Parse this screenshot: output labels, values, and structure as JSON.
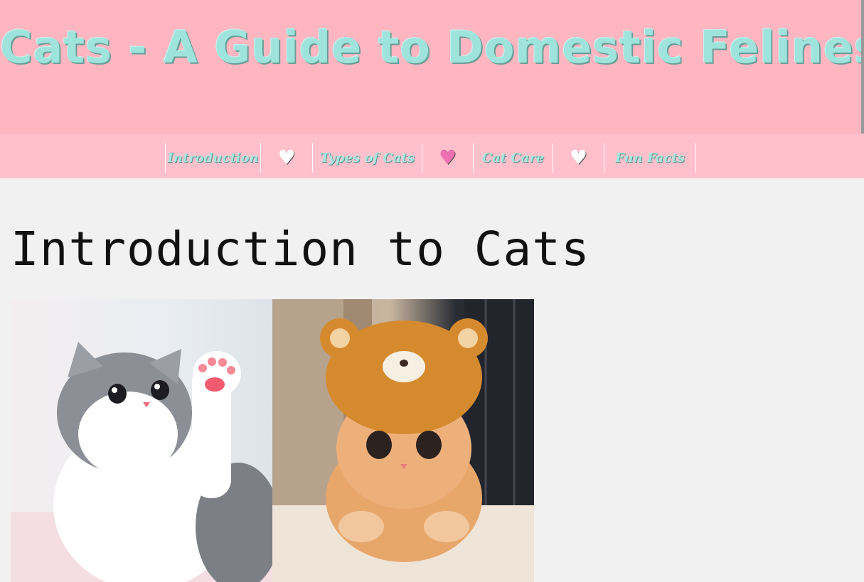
{
  "site": {
    "title": "Cats - A Guide to Domestic Felines"
  },
  "nav": {
    "items": [
      {
        "label": "Introduction",
        "kind": "link"
      },
      {
        "label": "♥",
        "kind": "heart",
        "color": "#ffffff"
      },
      {
        "label": "Types of Cats",
        "kind": "link"
      },
      {
        "label": "♥",
        "kind": "heart",
        "color": "#f06fb0"
      },
      {
        "label": "Cat Care",
        "kind": "link"
      },
      {
        "label": "♥",
        "kind": "heart",
        "color": "#ffffff"
      },
      {
        "label": "Fun Facts",
        "kind": "link"
      }
    ]
  },
  "main": {
    "heading": "Introduction to Cats",
    "images": [
      {
        "icon": "kitten-waving-photo",
        "alt": "Grey and white kitten raising a paw"
      },
      {
        "icon": "kitten-bear-hat-photo",
        "alt": "Orange kitten wearing a bear hat"
      }
    ]
  },
  "colors": {
    "header_bg": "#ffb6c1",
    "nav_bg": "#ffc0cb",
    "title_color": "#9ee4dc",
    "page_bg": "#f1f1f1"
  }
}
